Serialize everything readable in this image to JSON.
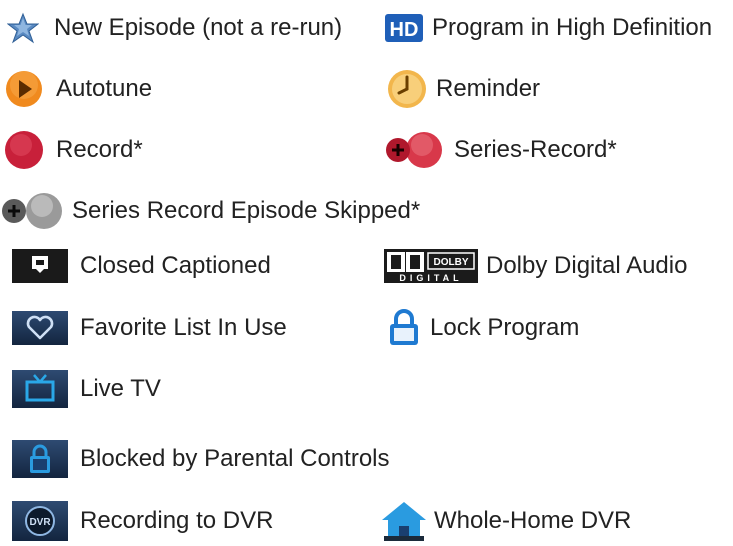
{
  "legend": {
    "items": [
      {
        "icon": "new-episode-star-icon",
        "label": "New Episode (not a re-run)"
      },
      {
        "icon": "hd-icon",
        "label": "Program in High Definition"
      },
      {
        "icon": "autotune-icon",
        "label": "Autotune"
      },
      {
        "icon": "reminder-clock-icon",
        "label": "Reminder"
      },
      {
        "icon": "record-icon",
        "label": "Record*"
      },
      {
        "icon": "series-record-icon",
        "label": "Series-Record*"
      },
      {
        "icon": "series-record-skipped-icon",
        "label": "Series Record Episode Skipped*"
      },
      {
        "icon": "closed-captioned-icon",
        "label": "Closed Captioned"
      },
      {
        "icon": "dolby-digital-icon",
        "label": "Dolby Digital Audio"
      },
      {
        "icon": "favorite-heart-icon",
        "label": "Favorite List In Use"
      },
      {
        "icon": "lock-icon",
        "label": "Lock Program"
      },
      {
        "icon": "live-tv-icon",
        "label": "Live TV"
      },
      {
        "icon": "parental-lock-icon",
        "label": "Blocked by Parental Controls"
      },
      {
        "icon": "dvr-icon",
        "label": "Recording to DVR"
      },
      {
        "icon": "whole-home-dvr-icon",
        "label": "Whole-Home DVR"
      }
    ],
    "hd_text": "HD",
    "dolby_text": "DOLBY",
    "dolby_sub": "DIGITAL",
    "dvr_text": "DVR"
  }
}
